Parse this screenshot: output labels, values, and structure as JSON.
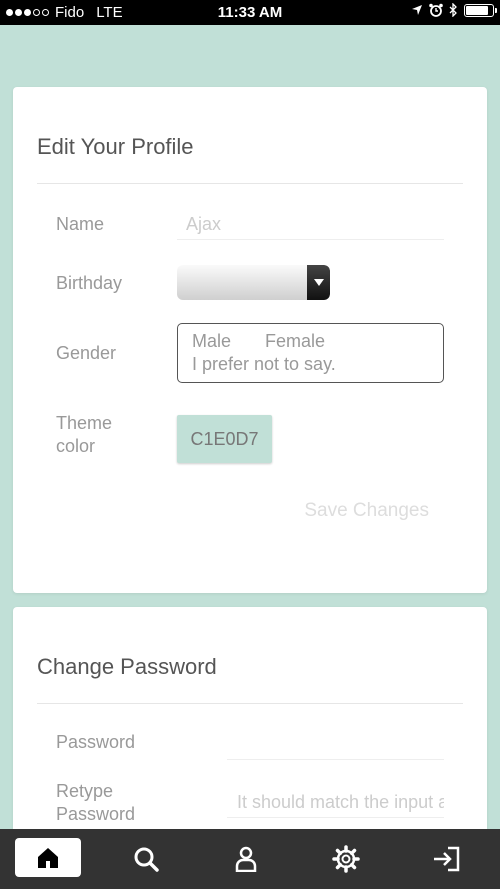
{
  "status_bar": {
    "carrier": "Fido",
    "network": "LTE",
    "time": "11:33 AM"
  },
  "profile_card": {
    "title": "Edit Your Profile",
    "name_label": "Name",
    "name_value": "Ajax",
    "birthday_label": "Birthday",
    "gender_label": "Gender",
    "gender_options": [
      "Male",
      "Female",
      "I prefer not to say."
    ],
    "theme_label": "Theme color",
    "theme_value": "C1E0D7",
    "save_label": "Save Changes"
  },
  "password_card": {
    "title": "Change Password",
    "password_label": "Password",
    "retype_label": "Retype Password",
    "retype_placeholder": "It should match the input above"
  },
  "tabbar": {
    "items": [
      "home-icon",
      "search-icon",
      "profile-icon",
      "settings-icon",
      "logout-icon"
    ]
  },
  "colors": {
    "background": "#c1e0d7",
    "tabbar": "#333333",
    "battery_level": 0.85
  }
}
